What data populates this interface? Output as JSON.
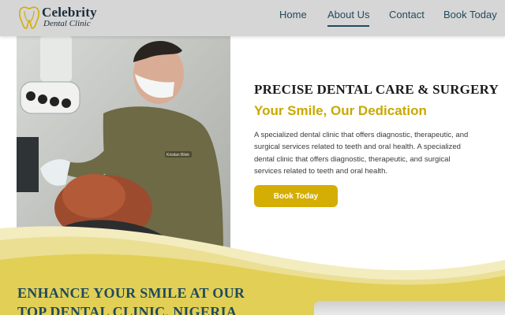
{
  "brand": {
    "logo_line1": "Celebrity",
    "logo_line2": "Dental Clinic",
    "accent_color": "#d4ad05",
    "nav_color": "#1f4a5e"
  },
  "nav": {
    "items": [
      {
        "label": "Home"
      },
      {
        "label": "About Us",
        "active": true
      },
      {
        "label": "Contact"
      },
      {
        "label": "Book Today"
      }
    ]
  },
  "hero": {
    "photo_icon": "dentist-photo",
    "photo_badge": "Kristian Bilek",
    "title": "PRECISE DENTAL CARE & SURGERY",
    "subtitle": "Your Smile, Our Dedication",
    "description": "A specialized dental clinic that offers diagnostic, therapeutic, and surgical services related to teeth and oral health. A specialized dental clinic that offers diagnostic, therapeutic, and surgical services related to teeth and oral health.",
    "button_label": "Book Today"
  },
  "section": {
    "title": "ENHANCE YOUR SMILE AT OUR TOP DENTAL CLINIC, NIGERIA"
  }
}
